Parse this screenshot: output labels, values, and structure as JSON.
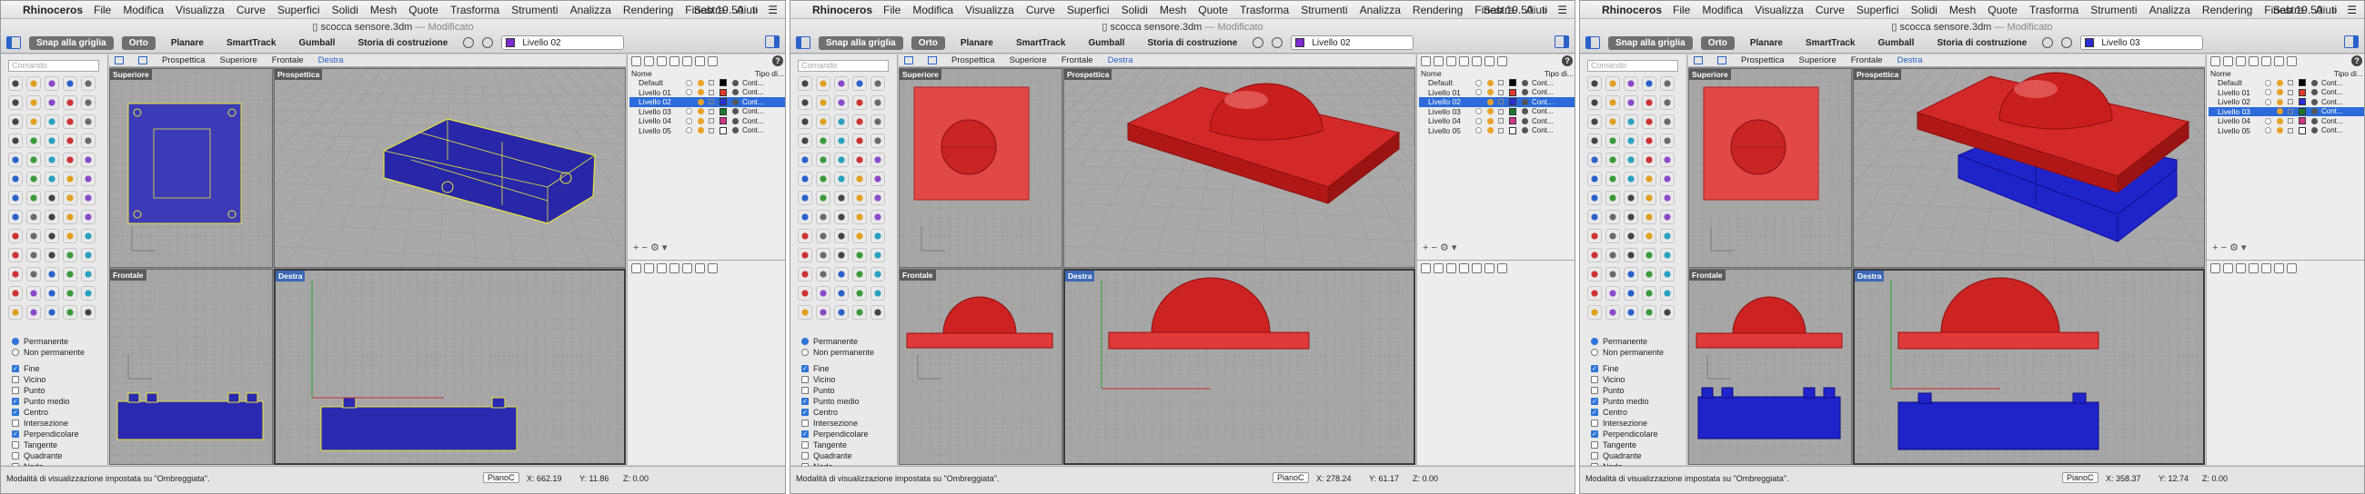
{
  "menubar": {
    "app": "Rhinoceros",
    "items": [
      "File",
      "Modifica",
      "Visualizza",
      "Curve",
      "Superfici",
      "Solidi",
      "Mesh",
      "Quote",
      "Trasforma",
      "Strumenti",
      "Analizza",
      "Rendering",
      "Finestra",
      "Aiuti"
    ],
    "clock": "Sab 19.50"
  },
  "title": {
    "file": "scocca sensore.3dm",
    "status": "— Modificato"
  },
  "toolbar": {
    "snap": "Snap alla griglia",
    "orto": "Orto",
    "planare": "Planare",
    "smarttrack": "SmartTrack",
    "gumball": "Gumball",
    "storia": "Storia di costruzione"
  },
  "command": {
    "placeholder": "Comando"
  },
  "viewport_tabs": {
    "prospettica": "Prospettica",
    "superiore": "Superiore",
    "frontale": "Frontale",
    "destra": "Destra"
  },
  "viewports": {
    "top": "Superiore",
    "persp": "Prospettica",
    "front": "Frontale",
    "right": "Destra"
  },
  "layers": {
    "col_name": "Nome",
    "col_type": "Tipo di...",
    "items": [
      {
        "name": "Default",
        "color": "#000000",
        "type": "Cont..."
      },
      {
        "name": "Livello 01",
        "color": "#e0392b",
        "type": "Cont..."
      },
      {
        "name": "Livello 02",
        "color": "#2a2fd6",
        "type": "Cont..."
      },
      {
        "name": "Livello 03",
        "color": "#1e7a2a",
        "type": "Cont..."
      },
      {
        "name": "Livello 04",
        "color": "#d4368a",
        "type": "Cont..."
      },
      {
        "name": "Livello 05",
        "color": "#ffffff",
        "type": "Cont..."
      }
    ],
    "footer": "+  −      ⚙ ▾"
  },
  "osnap": {
    "permanent": "Permanente",
    "nonpermanent": "Non permanente",
    "items": [
      {
        "label": "Fine",
        "on": true
      },
      {
        "label": "Vicino",
        "on": false
      },
      {
        "label": "Punto",
        "on": false
      },
      {
        "label": "Punto medio",
        "on": true
      },
      {
        "label": "Centro",
        "on": true
      },
      {
        "label": "Intersezione",
        "on": false
      },
      {
        "label": "Perpendicolare",
        "on": true
      },
      {
        "label": "Tangente",
        "on": false
      },
      {
        "label": "Quadrante",
        "on": false
      },
      {
        "label": "Nodo",
        "on": false
      }
    ]
  },
  "status": {
    "message": "Modalità di visualizzazione impostata su \"Ombreggiata\".",
    "cplane": "PianoC"
  },
  "windows": [
    {
      "current_layer": "Livello 02",
      "layer_swatch": "#7b2bd1",
      "selected_row": 2,
      "x": "X: 662.19",
      "y": "Y: 11.86",
      "z": "Z: 0.00"
    },
    {
      "current_layer": "Livello 02",
      "layer_swatch": "#7b2bd1",
      "selected_row": 2,
      "x": "X: 278.24",
      "y": "Y: 61.17",
      "z": "Z: 0.00"
    },
    {
      "current_layer": "Livello 03",
      "layer_swatch": "#2a2fd6",
      "selected_row": 3,
      "x": "X: 358.37",
      "y": "Y: 12.74",
      "z": "Z: 0.00"
    }
  ]
}
